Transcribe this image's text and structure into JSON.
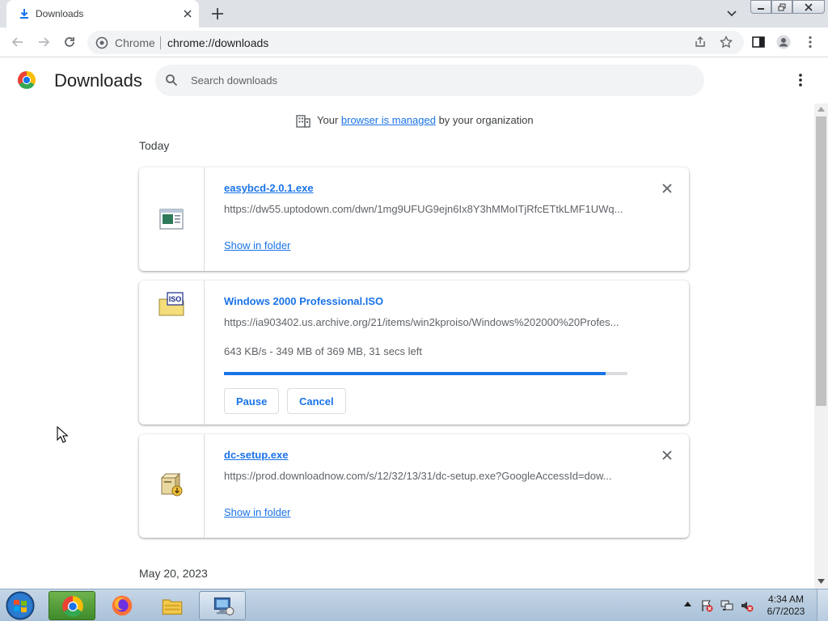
{
  "tab": {
    "title": "Downloads",
    "icon": "download-icon"
  },
  "toolbar": {
    "site_chip": "Chrome",
    "url": "chrome://downloads"
  },
  "page": {
    "title": "Downloads",
    "search_placeholder": "Search downloads"
  },
  "managed_notice": {
    "prefix": "Your ",
    "link": "browser is managed",
    "suffix": " by your organization"
  },
  "groups": [
    {
      "date": "Today"
    },
    {
      "date": "May 20, 2023"
    }
  ],
  "downloads": [
    {
      "name": "easybcd-2.0.1.exe",
      "url": "https://dw55.uptodown.com/dwn/1mg9UFUG9ejn6Ix8Y3hMMoITjRfcETtkLMF1UWq...",
      "action": "Show in folder",
      "icon": "exe-file-icon"
    },
    {
      "name": "Windows 2000 Professional.ISO",
      "url": "https://ia903402.us.archive.org/21/items/win2kproiso/Windows%202000%20Profes...",
      "status": "643 KB/s - 349 MB of 369 MB, 31 secs left",
      "progress_fraction": 0.946,
      "pause_label": "Pause",
      "cancel_label": "Cancel",
      "icon": "iso-file-icon"
    },
    {
      "name": "dc-setup.exe",
      "url": "https://prod.downloadnow.com/s/12/32/13/31/dc-setup.exe?GoogleAccessId=dow...",
      "action": "Show in folder",
      "icon": "installer-file-icon"
    }
  ],
  "taskbar": {
    "time": "4:34 AM",
    "date": "6/7/2023"
  },
  "colors": {
    "link": "#1a73e8",
    "tabstrip": "#dee1e6",
    "progress": "#1a73e8"
  }
}
